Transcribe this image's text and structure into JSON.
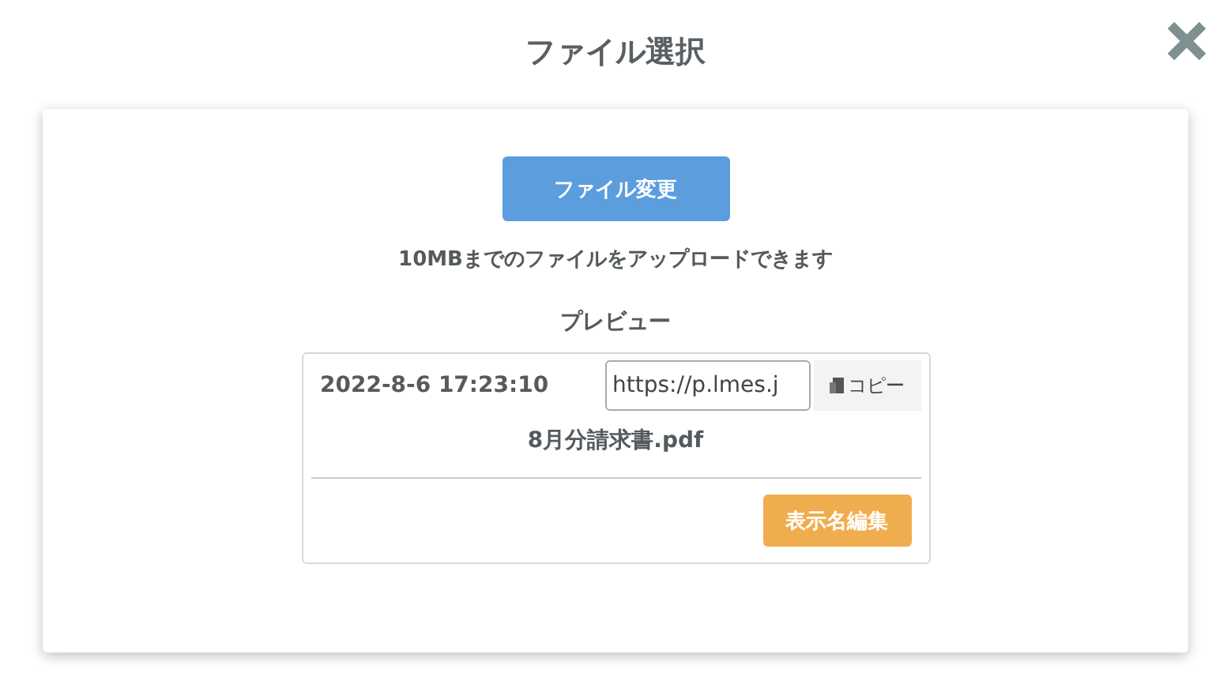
{
  "dialog": {
    "title": "ファイル選択",
    "change_button": "ファイル変更",
    "note": "10MBまでのファイルをアップロードできます",
    "preview_label": "プレビュー",
    "file": {
      "timestamp": "2022-8-6 17:23:10",
      "url": "https://p.lmes.j",
      "copy_button": "コピー",
      "name": "8月分請求書.pdf",
      "edit_button": "表示名編集"
    }
  }
}
